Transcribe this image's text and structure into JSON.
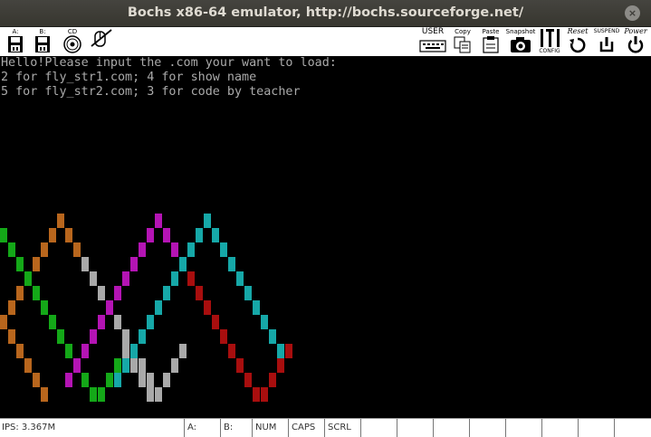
{
  "window": {
    "title": "Bochs x86-64 emulator, http://bochs.sourceforge.net/",
    "close_glyph": "×"
  },
  "toolbar": {
    "floppy_a": "A:",
    "floppy_b": "B:",
    "cdrom": "CD",
    "user": "USER",
    "copy": "Copy",
    "paste": "Paste",
    "snapshot": "Snapshot",
    "config": "CONFIG",
    "reset": "Reset",
    "suspend": "SUSPEND",
    "power": "Power"
  },
  "screen": {
    "lines": [
      "Hello!Please input the .com your want to load:",
      "2 for fly_str1.com; 4 for show name",
      "5 for fly_str2.com; 3 for code by teacher"
    ],
    "pattern_colors": {
      "orange": "#b8661d",
      "green": "#14a818",
      "gray": "#a9a9a9",
      "magenta": "#b414b4",
      "cyan": "#16a8a8",
      "red": "#a80e0e"
    }
  },
  "statusbar": {
    "ips": "IPS: 3.367M",
    "a": "A:",
    "b": "B:",
    "num": "NUM",
    "caps": "CAPS",
    "scrl": "SCRL"
  }
}
